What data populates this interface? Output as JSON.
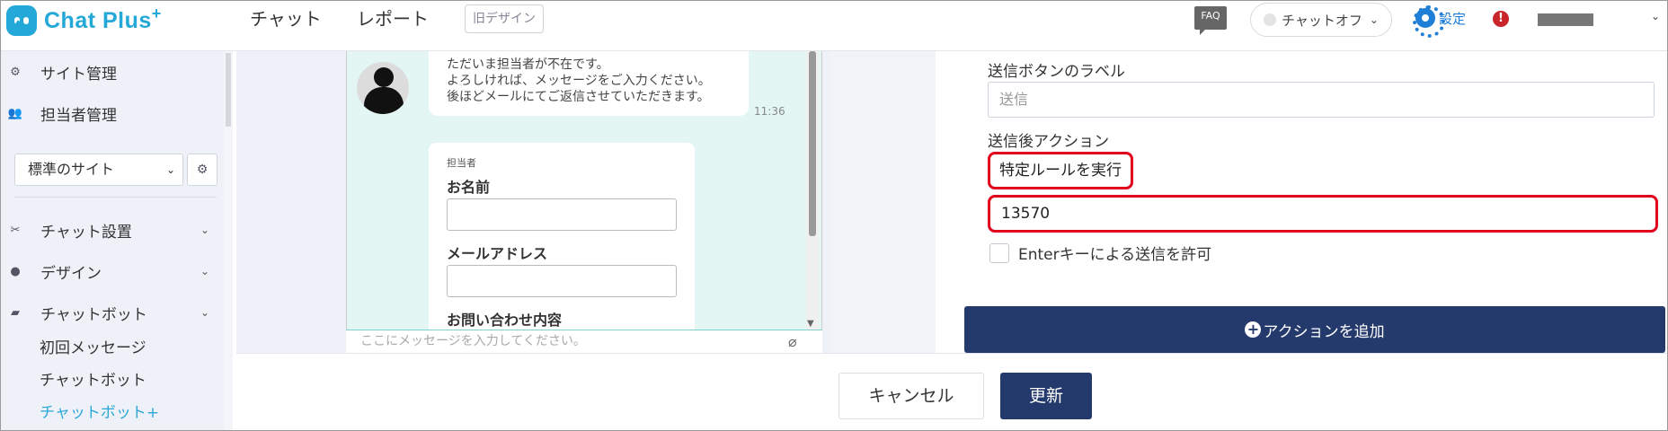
{
  "header": {
    "logo_text": "Chat Plus",
    "logo_plus": "+",
    "nav": [
      "チャット",
      "レポート"
    ],
    "old_design": "旧デザイン",
    "faq": "FAQ",
    "chat_status": "チャットオフ",
    "settings": "設定",
    "alert": "!"
  },
  "sidebar": {
    "items": [
      {
        "label": "サイト管理"
      },
      {
        "label": "担当者管理"
      }
    ],
    "site_select": "標準のサイト",
    "menu": [
      {
        "label": "チャット設置"
      },
      {
        "label": "デザイン"
      },
      {
        "label": "チャットボット"
      }
    ],
    "sub_items": [
      "初回メッセージ",
      "チャットボット",
      "チャットボット+"
    ]
  },
  "preview": {
    "message_lines": [
      "ただいま担当者が不在です。",
      "よろしければ、メッセージをご入力ください。",
      "後ほどメールにてご返信させていただきます。"
    ],
    "message_time": "11:36",
    "form_caption": "担当者",
    "form_fields": [
      "お名前",
      "メールアドレス",
      "お問い合わせ内容"
    ],
    "input_placeholder": "ここにメッセージを入力してください。"
  },
  "settings_panel": {
    "send_button_label_title": "送信ボタンのラベル",
    "send_button_label_value": "送信",
    "after_send_title": "送信後アクション",
    "after_send_value": "特定ルールを実行",
    "rule_id": "13570",
    "enter_key_label": "Enterキーによる送信を許可",
    "add_action": "アクションを追加"
  },
  "footer": {
    "cancel": "キャンセル",
    "update": "更新"
  },
  "colors": {
    "brand": "#24a8d8",
    "navy": "#253a6c",
    "highlight": "#e0001b",
    "chat_bg": "#e4f6f4"
  }
}
